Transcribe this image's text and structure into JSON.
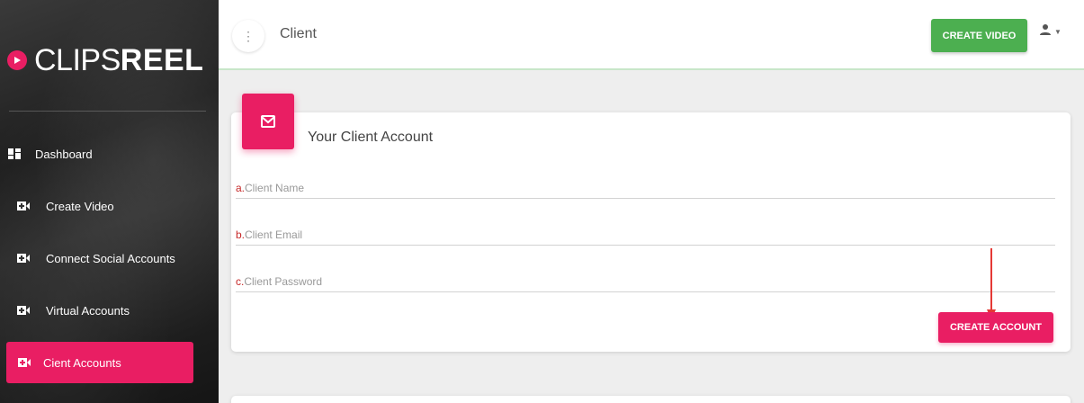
{
  "brand": {
    "name_thin": "CLIPS",
    "name_bold": "REEL",
    "accent": "#e91e63"
  },
  "sidebar": {
    "items": [
      {
        "label": "Dashboard",
        "icon": "dashboard-icon"
      },
      {
        "label": "Create Video",
        "icon": "video-camera-icon"
      },
      {
        "label": "Connect Social Accounts",
        "icon": "video-camera-icon"
      },
      {
        "label": "Virtual Accounts",
        "icon": "video-camera-icon"
      },
      {
        "label": "Cient Accounts",
        "icon": "video-camera-icon",
        "active": true
      }
    ]
  },
  "header": {
    "title": "Client",
    "create_video_label": "CREATE VIDEO",
    "create_video_color": "#4caf50"
  },
  "card": {
    "title": "Your Client Account",
    "icon": "mail-icon",
    "fields": [
      {
        "marker": "a.",
        "placeholder": "Client Name",
        "value": ""
      },
      {
        "marker": "b.",
        "placeholder": "Client Email",
        "value": ""
      },
      {
        "marker": "c.",
        "placeholder": "Client Password",
        "value": ""
      }
    ],
    "submit_label": "CREATE ACCOUNT"
  },
  "annotation": {
    "arrow_color": "#e53935"
  }
}
